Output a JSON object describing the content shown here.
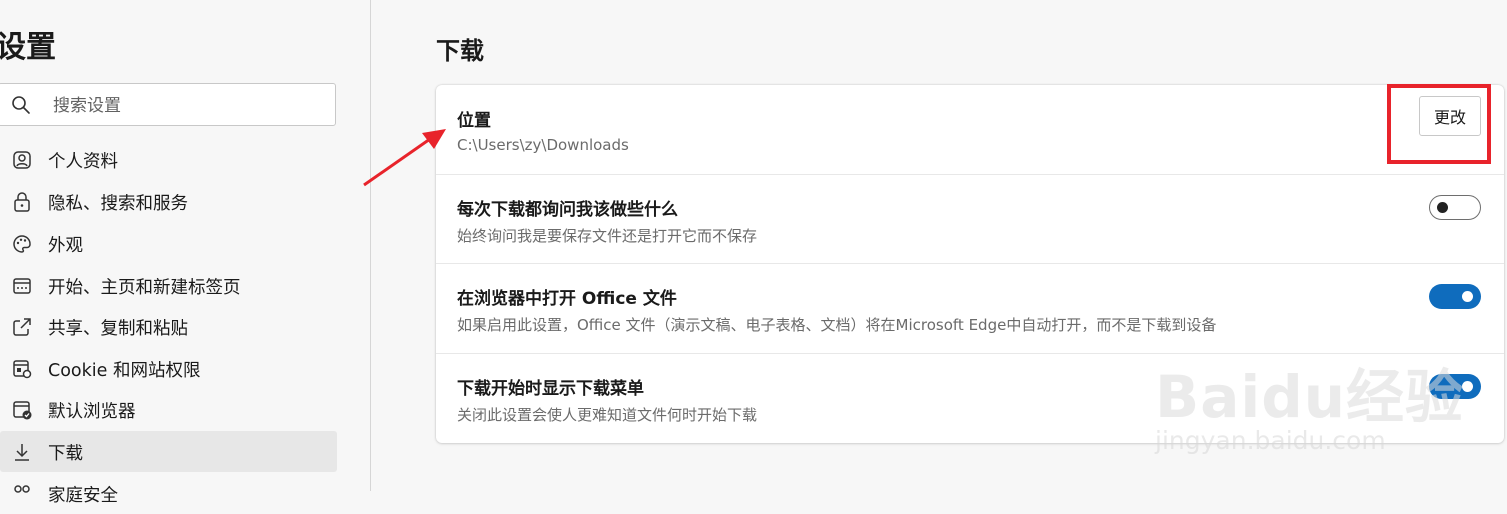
{
  "sidebar": {
    "title": "设置",
    "search": {
      "placeholder": "搜索设置",
      "icon": "search-icon"
    },
    "items": [
      {
        "label": "个人资料",
        "icon": "profile-icon"
      },
      {
        "label": "隐私、搜索和服务",
        "icon": "lock-icon"
      },
      {
        "label": "外观",
        "icon": "palette-icon"
      },
      {
        "label": "开始、主页和新建标签页",
        "icon": "home-tab-icon"
      },
      {
        "label": "共享、复制和粘贴",
        "icon": "share-icon"
      },
      {
        "label": "Cookie 和网站权限",
        "icon": "site-permissions-icon"
      },
      {
        "label": "默认浏览器",
        "icon": "default-browser-icon"
      },
      {
        "label": "下载",
        "icon": "download-icon",
        "active": true
      },
      {
        "label": "家庭安全",
        "icon": "family-icon"
      }
    ]
  },
  "main": {
    "title": "下载",
    "settings": [
      {
        "title": "位置",
        "description": "C:\\Users\\zy\\Downloads",
        "control": "button",
        "button_label": "更改"
      },
      {
        "title": "每次下载都询问我该做些什么",
        "description": "始终询问我是要保存文件还是打开它而不保存",
        "control": "toggle",
        "enabled": false
      },
      {
        "title": "在浏览器中打开 Office 文件",
        "description": "如果启用此设置，Office 文件（演示文稿、电子表格、文档）将在Microsoft Edge中自动打开，而不是下载到设备",
        "control": "toggle",
        "enabled": true
      },
      {
        "title": "下载开始时显示下载菜单",
        "description": "关闭此设置会使人更难知道文件何时开始下载",
        "control": "toggle",
        "enabled": true
      }
    ]
  },
  "colors": {
    "accent": "#0f6cbd",
    "annotation": "#e8232b",
    "background": "#f7f7f7"
  },
  "watermark": {
    "brand": "Baidu经验",
    "url": "jingyan.baidu.com"
  }
}
